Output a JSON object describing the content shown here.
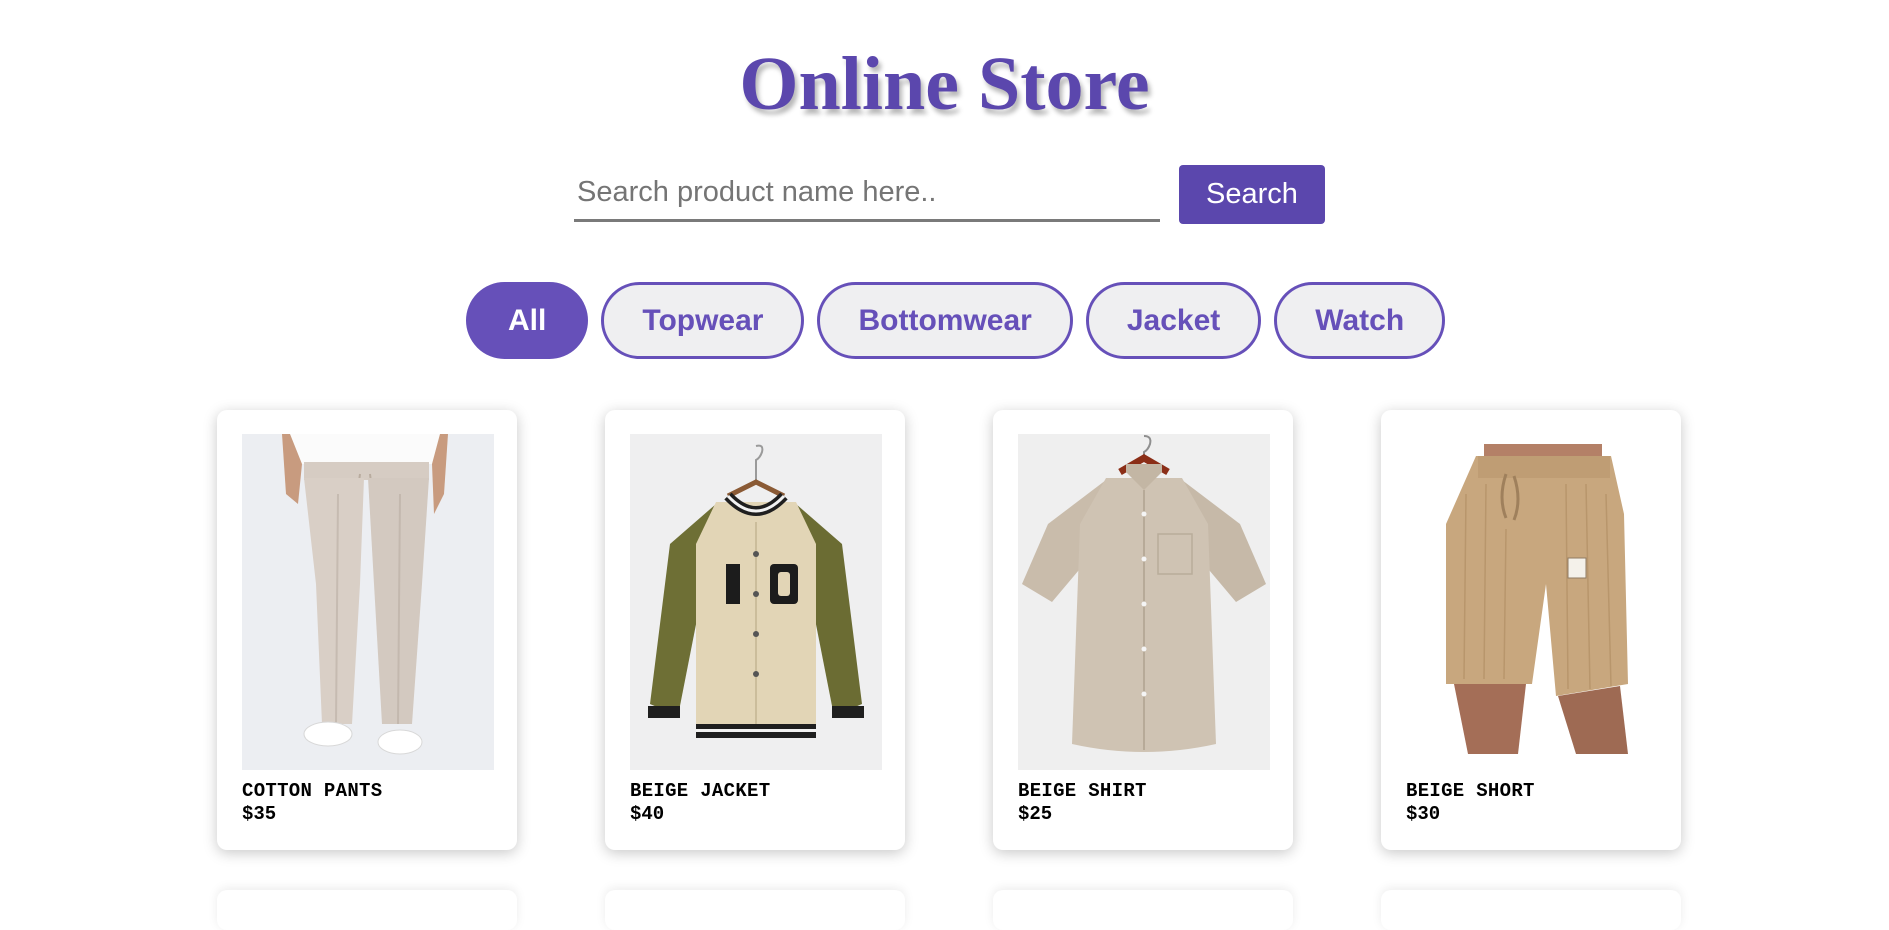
{
  "header": {
    "title": "Online Store"
  },
  "search": {
    "placeholder": "Search product name here..",
    "value": "",
    "button_label": "Search"
  },
  "filters": [
    {
      "label": "All",
      "active": true
    },
    {
      "label": "Topwear",
      "active": false
    },
    {
      "label": "Bottomwear",
      "active": false
    },
    {
      "label": "Jacket",
      "active": false
    },
    {
      "label": "Watch",
      "active": false
    }
  ],
  "products": [
    {
      "name": "COTTON PANTS",
      "price": "$35"
    },
    {
      "name": "BEIGE JACKET",
      "price": "$40"
    },
    {
      "name": "BEIGE SHIRT",
      "price": "$25"
    },
    {
      "name": "BEIGE SHORT",
      "price": "$30"
    }
  ],
  "colors": {
    "accent": "#5b47ad",
    "filter_accent": "#6650b9",
    "filter_bg": "#efeff1"
  }
}
